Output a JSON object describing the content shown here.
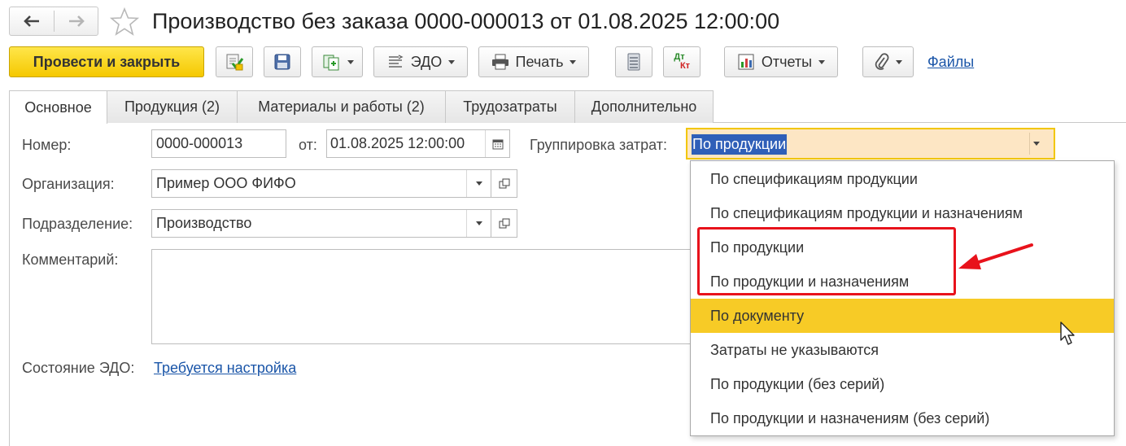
{
  "window": {
    "title": "Производство без заказа 0000-000013 от 01.08.2025 12:00:00"
  },
  "toolbar": {
    "post_close": "Провести и закрыть",
    "edo": "ЭДО",
    "print": "Печать",
    "reports": "Отчеты",
    "files": "Файлы",
    "dt_kt_top": "Дт",
    "dt_kt_bottom": "Кт"
  },
  "tabs": [
    {
      "label": "Основное"
    },
    {
      "label": "Продукция (2)"
    },
    {
      "label": "Материалы и работы (2)"
    },
    {
      "label": "Трудозатраты"
    },
    {
      "label": "Дополнительно"
    }
  ],
  "form": {
    "number_label": "Номер:",
    "number_value": "0000-000013",
    "date_label": "от:",
    "date_value": "01.08.2025 12:00:00",
    "grouping_label": "Группировка затрат:",
    "grouping_value": "По продукции",
    "org_label": "Организация:",
    "org_value": "Пример ООО ФИФО",
    "dept_label": "Подразделение:",
    "dept_value": "Производство",
    "comment_label": "Комментарий:",
    "edo_state_label": "Состояние ЭДО:",
    "edo_state_link": "Требуется настройка"
  },
  "dropdown": {
    "options": [
      {
        "label": "По спецификациям продукции"
      },
      {
        "label": "По спецификациям продукции и назначениям"
      },
      {
        "label": "По продукции"
      },
      {
        "label": "По продукции и назначениям"
      },
      {
        "label": "По документу"
      },
      {
        "label": "Затраты не указываются"
      },
      {
        "label": "По продукции (без серий)"
      },
      {
        "label": "По продукции и назначениям (без серий)"
      }
    ],
    "highlighted_index": 4
  },
  "colors": {
    "primary_button": "#f5c800",
    "highlight": "#f7cb26",
    "annotation_red": "#e8121b",
    "link": "#1a55a8"
  }
}
